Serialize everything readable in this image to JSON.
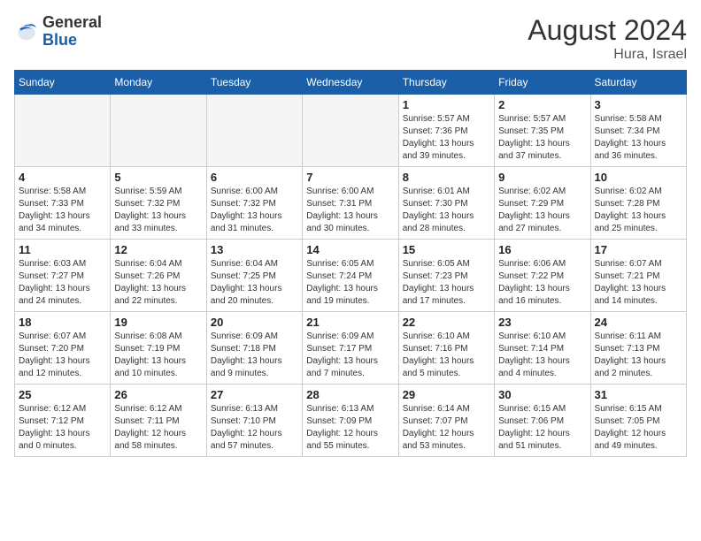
{
  "header": {
    "logo_general": "General",
    "logo_blue": "Blue",
    "month_year": "August 2024",
    "location": "Hura, Israel"
  },
  "weekdays": [
    "Sunday",
    "Monday",
    "Tuesday",
    "Wednesday",
    "Thursday",
    "Friday",
    "Saturday"
  ],
  "weeks": [
    [
      {
        "day": "",
        "info": ""
      },
      {
        "day": "",
        "info": ""
      },
      {
        "day": "",
        "info": ""
      },
      {
        "day": "",
        "info": ""
      },
      {
        "day": "1",
        "info": "Sunrise: 5:57 AM\nSunset: 7:36 PM\nDaylight: 13 hours\nand 39 minutes."
      },
      {
        "day": "2",
        "info": "Sunrise: 5:57 AM\nSunset: 7:35 PM\nDaylight: 13 hours\nand 37 minutes."
      },
      {
        "day": "3",
        "info": "Sunrise: 5:58 AM\nSunset: 7:34 PM\nDaylight: 13 hours\nand 36 minutes."
      }
    ],
    [
      {
        "day": "4",
        "info": "Sunrise: 5:58 AM\nSunset: 7:33 PM\nDaylight: 13 hours\nand 34 minutes."
      },
      {
        "day": "5",
        "info": "Sunrise: 5:59 AM\nSunset: 7:32 PM\nDaylight: 13 hours\nand 33 minutes."
      },
      {
        "day": "6",
        "info": "Sunrise: 6:00 AM\nSunset: 7:32 PM\nDaylight: 13 hours\nand 31 minutes."
      },
      {
        "day": "7",
        "info": "Sunrise: 6:00 AM\nSunset: 7:31 PM\nDaylight: 13 hours\nand 30 minutes."
      },
      {
        "day": "8",
        "info": "Sunrise: 6:01 AM\nSunset: 7:30 PM\nDaylight: 13 hours\nand 28 minutes."
      },
      {
        "day": "9",
        "info": "Sunrise: 6:02 AM\nSunset: 7:29 PM\nDaylight: 13 hours\nand 27 minutes."
      },
      {
        "day": "10",
        "info": "Sunrise: 6:02 AM\nSunset: 7:28 PM\nDaylight: 13 hours\nand 25 minutes."
      }
    ],
    [
      {
        "day": "11",
        "info": "Sunrise: 6:03 AM\nSunset: 7:27 PM\nDaylight: 13 hours\nand 24 minutes."
      },
      {
        "day": "12",
        "info": "Sunrise: 6:04 AM\nSunset: 7:26 PM\nDaylight: 13 hours\nand 22 minutes."
      },
      {
        "day": "13",
        "info": "Sunrise: 6:04 AM\nSunset: 7:25 PM\nDaylight: 13 hours\nand 20 minutes."
      },
      {
        "day": "14",
        "info": "Sunrise: 6:05 AM\nSunset: 7:24 PM\nDaylight: 13 hours\nand 19 minutes."
      },
      {
        "day": "15",
        "info": "Sunrise: 6:05 AM\nSunset: 7:23 PM\nDaylight: 13 hours\nand 17 minutes."
      },
      {
        "day": "16",
        "info": "Sunrise: 6:06 AM\nSunset: 7:22 PM\nDaylight: 13 hours\nand 16 minutes."
      },
      {
        "day": "17",
        "info": "Sunrise: 6:07 AM\nSunset: 7:21 PM\nDaylight: 13 hours\nand 14 minutes."
      }
    ],
    [
      {
        "day": "18",
        "info": "Sunrise: 6:07 AM\nSunset: 7:20 PM\nDaylight: 13 hours\nand 12 minutes."
      },
      {
        "day": "19",
        "info": "Sunrise: 6:08 AM\nSunset: 7:19 PM\nDaylight: 13 hours\nand 10 minutes."
      },
      {
        "day": "20",
        "info": "Sunrise: 6:09 AM\nSunset: 7:18 PM\nDaylight: 13 hours\nand 9 minutes."
      },
      {
        "day": "21",
        "info": "Sunrise: 6:09 AM\nSunset: 7:17 PM\nDaylight: 13 hours\nand 7 minutes."
      },
      {
        "day": "22",
        "info": "Sunrise: 6:10 AM\nSunset: 7:16 PM\nDaylight: 13 hours\nand 5 minutes."
      },
      {
        "day": "23",
        "info": "Sunrise: 6:10 AM\nSunset: 7:14 PM\nDaylight: 13 hours\nand 4 minutes."
      },
      {
        "day": "24",
        "info": "Sunrise: 6:11 AM\nSunset: 7:13 PM\nDaylight: 13 hours\nand 2 minutes."
      }
    ],
    [
      {
        "day": "25",
        "info": "Sunrise: 6:12 AM\nSunset: 7:12 PM\nDaylight: 13 hours\nand 0 minutes."
      },
      {
        "day": "26",
        "info": "Sunrise: 6:12 AM\nSunset: 7:11 PM\nDaylight: 12 hours\nand 58 minutes."
      },
      {
        "day": "27",
        "info": "Sunrise: 6:13 AM\nSunset: 7:10 PM\nDaylight: 12 hours\nand 57 minutes."
      },
      {
        "day": "28",
        "info": "Sunrise: 6:13 AM\nSunset: 7:09 PM\nDaylight: 12 hours\nand 55 minutes."
      },
      {
        "day": "29",
        "info": "Sunrise: 6:14 AM\nSunset: 7:07 PM\nDaylight: 12 hours\nand 53 minutes."
      },
      {
        "day": "30",
        "info": "Sunrise: 6:15 AM\nSunset: 7:06 PM\nDaylight: 12 hours\nand 51 minutes."
      },
      {
        "day": "31",
        "info": "Sunrise: 6:15 AM\nSunset: 7:05 PM\nDaylight: 12 hours\nand 49 minutes."
      }
    ]
  ]
}
